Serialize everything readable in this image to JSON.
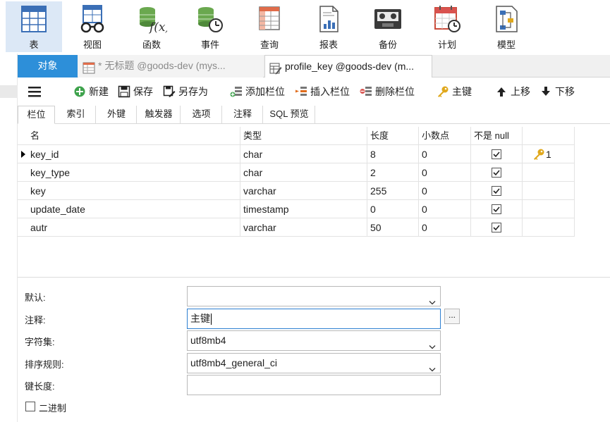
{
  "ribbon": [
    {
      "key": "table",
      "label": "表",
      "icon": "table-icon",
      "active": true
    },
    {
      "key": "view",
      "label": "视图",
      "icon": "view-glasses-icon"
    },
    {
      "key": "function",
      "label": "函数",
      "icon": "function-fx-icon"
    },
    {
      "key": "event",
      "label": "事件",
      "icon": "event-clock-icon"
    },
    {
      "key": "query",
      "label": "查询",
      "icon": "query-table-icon"
    },
    {
      "key": "report",
      "label": "报表",
      "icon": "report-chart-icon"
    },
    {
      "key": "backup",
      "label": "备份",
      "icon": "backup-tape-icon"
    },
    {
      "key": "schedule",
      "label": "计划",
      "icon": "schedule-calendar-icon"
    },
    {
      "key": "model",
      "label": "模型",
      "icon": "model-diagram-icon"
    }
  ],
  "doc_tabs": {
    "objects": "对象",
    "untitled": "* 无标题 @goods-dev (mys...",
    "profile": "profile_key @goods-dev (m..."
  },
  "toolbar": {
    "new": "新建",
    "save": "保存",
    "save_as": "另存为",
    "add_field": "添加栏位",
    "insert_field": "插入栏位",
    "delete_field": "删除栏位",
    "primary_key": "主键",
    "move_up": "上移",
    "move_down": "下移"
  },
  "sub_tabs": [
    "栏位",
    "索引",
    "外键",
    "触发器",
    "选项",
    "注释",
    "SQL 预览"
  ],
  "grid": {
    "headers": [
      "名",
      "类型",
      "长度",
      "小数点",
      "不是 null",
      ""
    ],
    "rows": [
      {
        "name": "key_id",
        "type": "char",
        "length": "8",
        "decimals": "0",
        "not_null": true,
        "key": "1",
        "current": true
      },
      {
        "name": "key_type",
        "type": "char",
        "length": "2",
        "decimals": "0",
        "not_null": true,
        "key": ""
      },
      {
        "name": "key",
        "type": "varchar",
        "length": "255",
        "decimals": "0",
        "not_null": true,
        "key": ""
      },
      {
        "name": "update_date",
        "type": "timestamp",
        "length": "0",
        "decimals": "0",
        "not_null": true,
        "key": ""
      },
      {
        "name": "autr",
        "type": "varchar",
        "length": "50",
        "decimals": "0",
        "not_null": true,
        "key": ""
      }
    ]
  },
  "props": {
    "default_label": "默认:",
    "default_value": "",
    "comment_label": "注释:",
    "comment_value": "主键",
    "ellipsis": "...",
    "charset_label": "字符集:",
    "charset_value": "utf8mb4",
    "collation_label": "排序规则:",
    "collation_value": "utf8mb4_general_ci",
    "keylen_label": "键长度:",
    "keylen_value": "",
    "binary_label": "二进制"
  },
  "colors": {
    "accent": "#2d8fd9",
    "active_ribbon": "#dce8f6",
    "key_gold": "#e0a81c"
  }
}
